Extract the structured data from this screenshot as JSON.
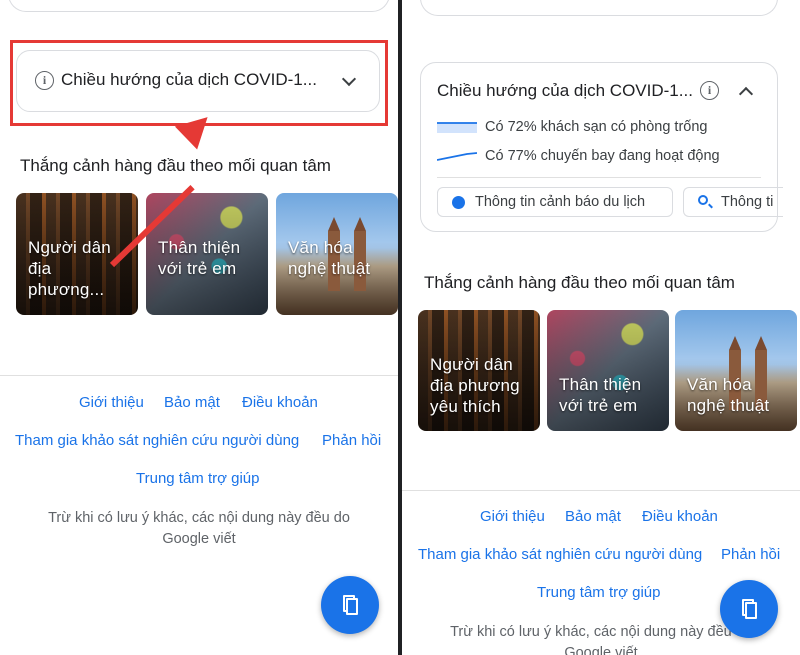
{
  "left": {
    "covid": {
      "title": "Chiều hướng của dịch COVID-1..."
    },
    "section_title": "Thắng cảnh hàng đầu theo mối quan tâm",
    "tiles": [
      {
        "label": "Người dân địa phương..."
      },
      {
        "label": "Thân thiện với trẻ em"
      },
      {
        "label": "Văn hóa nghệ thuật"
      }
    ],
    "footer": {
      "links_row1": [
        "Giới thiệu",
        "Bảo mật",
        "Điều khoản"
      ],
      "survey": "Tham gia khảo sát nghiên cứu người dùng",
      "feedback": "Phản hồi",
      "help": "Trung tâm trợ giúp",
      "note": "Trừ khi có lưu ý khác, các nội dung này đều do Google viết"
    }
  },
  "right": {
    "covid": {
      "title": "Chiều hướng của dịch COVID-1...",
      "stats": [
        "Có 72% khách sạn có phòng trống",
        "Có 77% chuyến bay đang hoạt động"
      ],
      "chips": [
        "Thông tin cảnh báo du lịch",
        "Thông ti"
      ]
    },
    "section_title": "Thắng cảnh hàng đầu theo mối quan tâm",
    "tiles": [
      {
        "label": "Người dân địa phương yêu thích"
      },
      {
        "label": "Thân thiện với trẻ em"
      },
      {
        "label": "Văn hóa nghệ thuật"
      }
    ],
    "footer": {
      "links_row1": [
        "Giới thiệu",
        "Bảo mật",
        "Điều khoản"
      ],
      "survey": "Tham gia khảo sát nghiên cứu người dùng",
      "feedback": "Phản hồi",
      "help": "Trung tâm trợ giúp",
      "note": "Trừ khi có lưu ý khác, các nội dung này đều do Google viết"
    }
  },
  "icons": {
    "info": "i",
    "chevron": "chevron-down-icon",
    "chevron_up": "chevron-up-icon",
    "bookmark": "bookmark-icon"
  },
  "colors": {
    "accent": "#1a73e8",
    "highlight": "#e53935"
  }
}
